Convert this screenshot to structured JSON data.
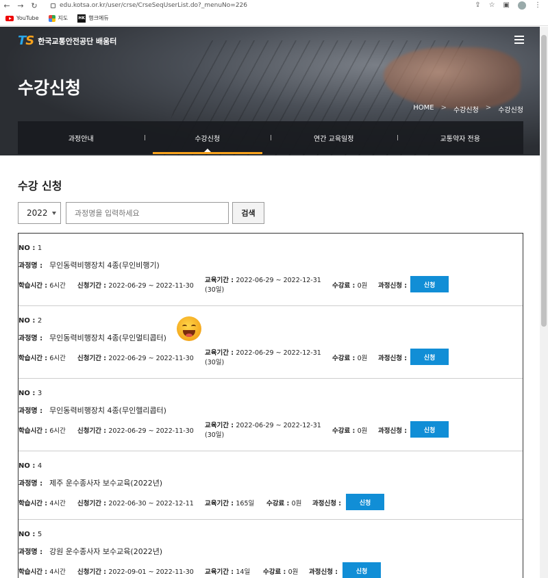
{
  "browser": {
    "url": "edu.kotsa.or.kr/user/crse/CrseSeqUserList.do?_menuNo=226",
    "bookmarks": [
      "YouTube",
      "지도",
      "행크에듀"
    ]
  },
  "header": {
    "logo_mark": "TS",
    "logo_text": "한국교통안전공단 배움터",
    "title": "수강신청",
    "breadcrumb": [
      "HOME",
      "수강신청",
      "수강신청"
    ],
    "tabs": [
      "과정안내",
      "수강신청",
      "연간 교육일정",
      "교통약자 전용"
    ]
  },
  "main": {
    "section_title": "수강 신청",
    "year": "2022",
    "search_placeholder": "과정명을 입력하세요",
    "search_label": "검색"
  },
  "labels": {
    "no": "NO",
    "course": "과정명",
    "hours": "학습시간",
    "apply_period": "신청기간",
    "edu_period": "교육기간",
    "fee": "수강료",
    "apply": "과정신청",
    "apply_button": "신청"
  },
  "courses": [
    {
      "no": "1",
      "name": "무인동력비행장치 4종(무인비행기)",
      "hours": "6시간",
      "apply_period": "2022-06-29 ~ 2022-11-30",
      "edu_period": "2022-06-29 ~ 2022-12-31",
      "edu_days": "(30일)",
      "fee": "0원"
    },
    {
      "no": "2",
      "name": "무인동력비행장치 4종(무인멀티콥터)",
      "hours": "6시간",
      "apply_period": "2022-06-29 ~ 2022-11-30",
      "edu_period": "2022-06-29 ~ 2022-12-31",
      "edu_days": "(30일)",
      "fee": "0원"
    },
    {
      "no": "3",
      "name": "무인동력비행장치 4종(무인헬리콥터)",
      "hours": "6시간",
      "apply_period": "2022-06-29 ~ 2022-11-30",
      "edu_period": "2022-06-29 ~ 2022-12-31",
      "edu_days": "(30일)",
      "fee": "0원"
    },
    {
      "no": "4",
      "name": "제주 운수종사자 보수교육(2022년)",
      "hours": "4시간",
      "apply_period": "2022-06-30 ~ 2022-12-11",
      "edu_period": "165일",
      "fee": "0원"
    },
    {
      "no": "5",
      "name": "강원 운수종사자 보수교육(2022년)",
      "hours": "4시간",
      "apply_period": "2022-09-01 ~ 2022-11-30",
      "edu_period": "14일",
      "fee": "0원"
    }
  ]
}
